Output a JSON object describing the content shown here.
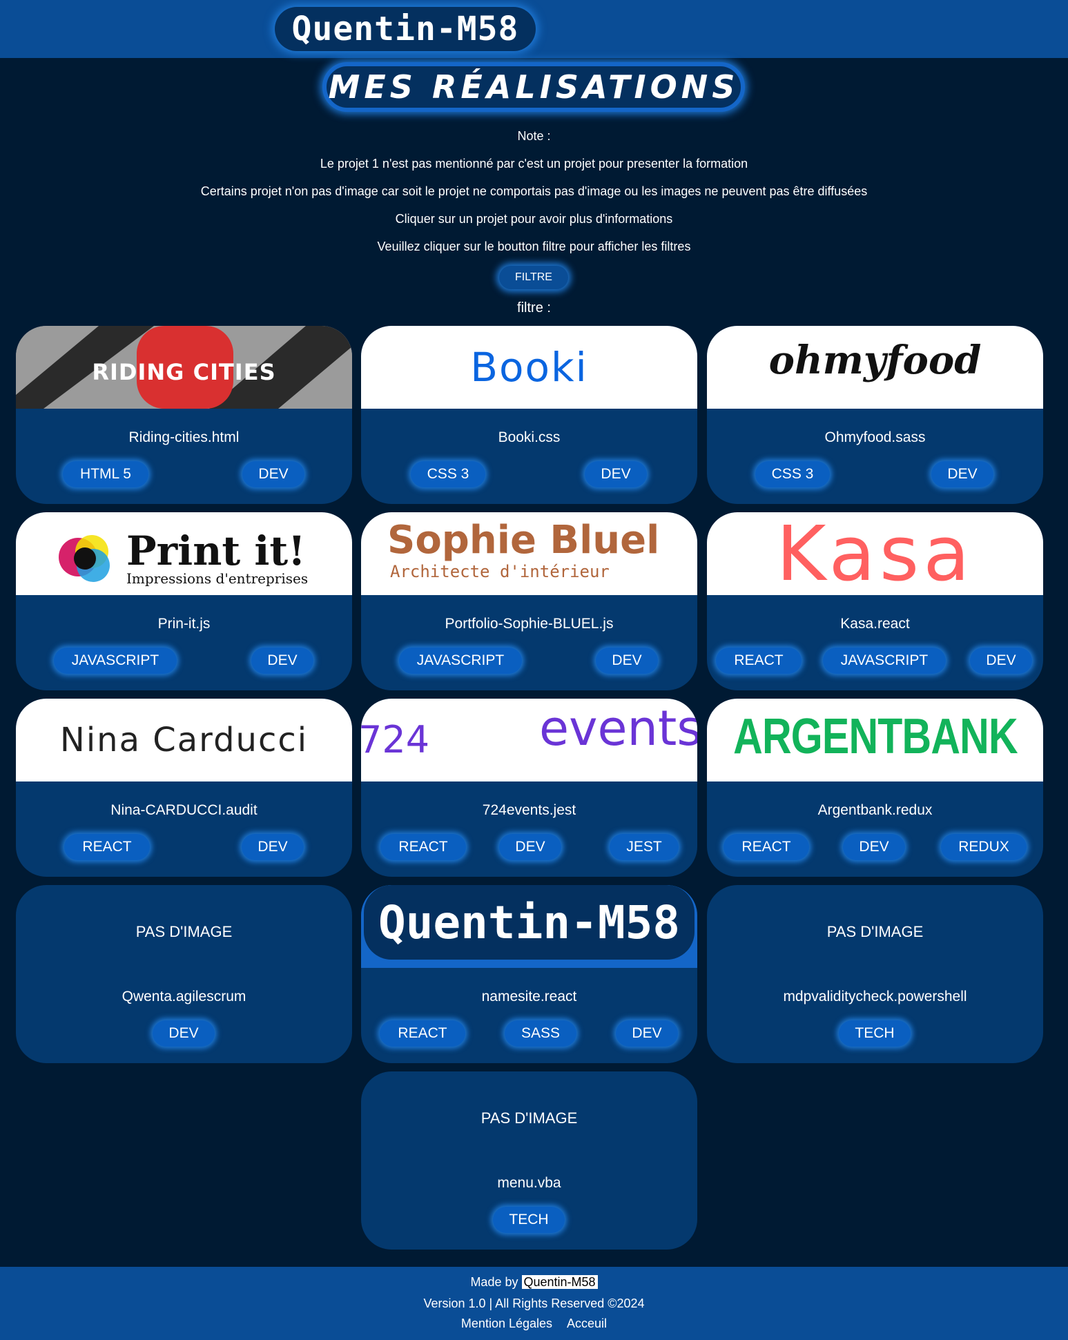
{
  "header": {
    "logo_text": "Quentin-M58",
    "page_title": "MES RÉALISATIONS"
  },
  "notes": [
    "Note :",
    "Le projet 1 n'est pas mentionné par c'est un projet pour presenter la formation",
    "Certains projet n'on pas d'image car soit le projet ne comportais pas d'image ou les images ne peuvent pas être diffusées",
    "Cliquer sur un projet pour avoir plus d'informations",
    "Veuillez cliquer sur le boutton filtre pour afficher les filtres"
  ],
  "filter": {
    "button_label": "FILTRE",
    "label": "filtre :"
  },
  "projects": [
    {
      "image_text": "RIDING CITIES",
      "title": "Riding-cities.html",
      "tags": [
        "HTML 5",
        "DEV"
      ]
    },
    {
      "image_text": "Booki",
      "title": "Booki.css",
      "tags": [
        "CSS 3",
        "DEV"
      ]
    },
    {
      "image_text": "ohmyfood",
      "title": "Ohmyfood.sass",
      "tags": [
        "CSS 3",
        "DEV"
      ]
    },
    {
      "image_text": "Print it!",
      "image_subtext": "Impressions d'entreprises",
      "title": "Prin-it.js",
      "tags": [
        "JAVASCRIPT",
        "DEV"
      ]
    },
    {
      "image_text": "Sophie Bluel",
      "image_subtext": "Architecte d'intérieur",
      "title": "Portfolio-Sophie-BLUEL.js",
      "tags": [
        "JAVASCRIPT",
        "DEV"
      ]
    },
    {
      "image_text": "Kasa",
      "title": "Kasa.react",
      "tags": [
        "REACT",
        "JAVASCRIPT",
        "DEV"
      ]
    },
    {
      "image_text": "Nina Carducci",
      "title": "Nina-CARDUCCI.audit",
      "tags": [
        "REACT",
        "DEV"
      ]
    },
    {
      "image_text": "724",
      "image_subtext": "events",
      "title": "724events.jest",
      "tags": [
        "REACT",
        "DEV",
        "JEST"
      ]
    },
    {
      "image_text": "ARGENTBANK",
      "title": "Argentbank.redux",
      "tags": [
        "REACT",
        "DEV",
        "REDUX"
      ]
    },
    {
      "no_image_text": "PAS D'IMAGE",
      "title": "Qwenta.agilescrum",
      "tags": [
        "DEV"
      ]
    },
    {
      "image_text": "Quentin-M58",
      "title": "namesite.react",
      "tags": [
        "REACT",
        "SASS",
        "DEV"
      ]
    },
    {
      "no_image_text": "PAS D'IMAGE",
      "title": "mdpvaliditycheck.powershell",
      "tags": [
        "TECH"
      ]
    },
    {
      "no_image_text": "PAS D'IMAGE",
      "title": "menu.vba",
      "tags": [
        "TECH"
      ]
    }
  ],
  "footer": {
    "made_by_prefix": "Made by",
    "made_by_name": "Quentin-M58",
    "version_text": "Version 1.0 | All Rights Reserved ©2024",
    "links": [
      "Mention Légales",
      "Acceuil"
    ]
  },
  "colors": {
    "background": "#001a33",
    "header_bar": "#0a4d96",
    "card": "#04396e",
    "tag": "#0a5fc0",
    "glow": "#1f7ad8"
  }
}
